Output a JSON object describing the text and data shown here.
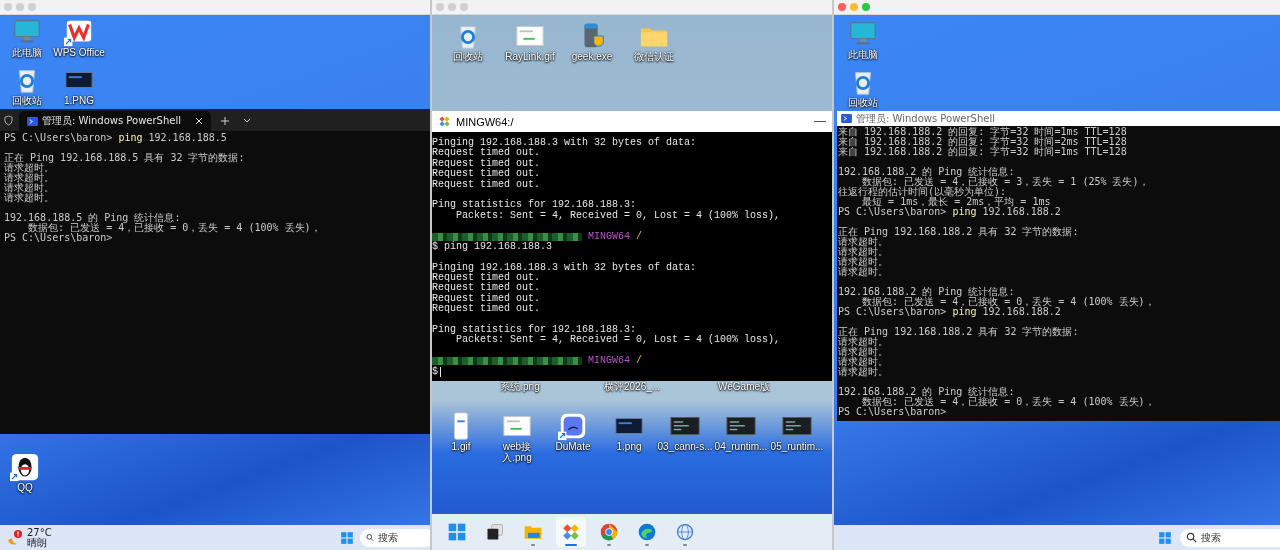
{
  "left_session": {
    "titlebar": {
      "active": false
    },
    "desktop_icons": [
      {
        "label": "此电脑",
        "kind": "monitor",
        "shortcut": false
      },
      {
        "label": "WPS Office",
        "kind": "wps",
        "shortcut": true
      },
      {
        "label": "回收站",
        "kind": "recycle",
        "shortcut": false
      },
      {
        "label": "1.PNG",
        "kind": "dark-thumb",
        "shortcut": false
      }
    ],
    "terminal": {
      "tab": {
        "title": "管理员: Windows PowerShell",
        "selected": true
      },
      "lines": [
        {
          "kind": "command",
          "prompt": "PS C:\\Users\\baron>",
          "command": "ping",
          "args": "192.168.188.5"
        },
        {
          "kind": "blank"
        },
        {
          "kind": "output",
          "text": "正在 Ping 192.168.188.5 具有 32 字节的数据:"
        },
        {
          "kind": "output",
          "text": "请求超时。"
        },
        {
          "kind": "output",
          "text": "请求超时。"
        },
        {
          "kind": "output",
          "text": "请求超时。"
        },
        {
          "kind": "output",
          "text": "请求超时。"
        },
        {
          "kind": "blank"
        },
        {
          "kind": "output",
          "text": "192.168.188.5 的 Ping 统计信息:"
        },
        {
          "kind": "output",
          "text": "    数据包: 已发送 = 4，已接收 = 0，丢失 = 4 (100% 丢失)，"
        },
        {
          "kind": "prompt",
          "prompt": "PS C:\\Users\\baron>"
        }
      ]
    },
    "lower_icons": [
      {
        "label": "QQ",
        "kind": "qq",
        "shortcut": true
      }
    ],
    "taskbar": {
      "weather": {
        "temperature": "27°C",
        "condition": "晴朗"
      },
      "search": {
        "placeholder": "搜索"
      }
    }
  },
  "center_session": {
    "titlebar": {
      "active": false
    },
    "desktop_icons": [
      {
        "label": "回收站",
        "kind": "recycle",
        "shortcut": false
      },
      {
        "label": "RayLink.gif",
        "kind": "gif-thumb",
        "shortcut": false
      },
      {
        "label": "geek.exe",
        "kind": "exe",
        "shortcut": false
      },
      {
        "label": "微信认证",
        "kind": "folder",
        "shortcut": false
      }
    ],
    "terminal": {
      "title": "MINGW64:/",
      "lines": [
        {
          "kind": "output",
          "text": "Pinging 192.168.188.3 with 32 bytes of data:"
        },
        {
          "kind": "output",
          "text": "Request timed out."
        },
        {
          "kind": "output",
          "text": "Request timed out."
        },
        {
          "kind": "output",
          "text": "Request timed out."
        },
        {
          "kind": "output",
          "text": "Request timed out."
        },
        {
          "kind": "blank"
        },
        {
          "kind": "output",
          "text": "Ping statistics for 192.168.188.3:"
        },
        {
          "kind": "output",
          "text": "    Packets: Sent = 4, Received = 0, Lost = 4 (100% loss),"
        },
        {
          "kind": "blank"
        },
        {
          "kind": "prompt",
          "host": "MINGW64",
          "path": "/"
        },
        {
          "kind": "input",
          "symbol": "$",
          "text": "ping 192.168.188.3"
        },
        {
          "kind": "blank"
        },
        {
          "kind": "output",
          "text": "Pinging 192.168.188.3 with 32 bytes of data:"
        },
        {
          "kind": "output",
          "text": "Request timed out."
        },
        {
          "kind": "output",
          "text": "Request timed out."
        },
        {
          "kind": "output",
          "text": "Request timed out."
        },
        {
          "kind": "output",
          "text": "Request timed out."
        },
        {
          "kind": "blank"
        },
        {
          "kind": "output",
          "text": "Ping statistics for 192.168.188.3:"
        },
        {
          "kind": "output",
          "text": "    Packets: Sent = 4, Received = 0, Lost = 4 (100% loss),"
        },
        {
          "kind": "blank"
        },
        {
          "kind": "prompt",
          "host": "MINGW64",
          "path": "/"
        },
        {
          "kind": "cursor",
          "symbol": "$"
        }
      ]
    },
    "hidden_row_labels": [
      "系统.png",
      "横评2026_...",
      "WeGame版"
    ],
    "lower_icons": [
      {
        "label": "1.gif",
        "kind": "phone-thumb",
        "shortcut": false
      },
      {
        "label": "web接入.png",
        "kind": "gif-thumb",
        "shortcut": false
      },
      {
        "label": "DuMate",
        "kind": "app",
        "shortcut": true
      },
      {
        "label": "1.png",
        "kind": "dark-thumb",
        "shortcut": false
      },
      {
        "label": "03_cann-s...",
        "kind": "code-thumb",
        "shortcut": false
      },
      {
        "label": "04_runtim...",
        "kind": "code-thumb",
        "shortcut": false
      },
      {
        "label": "05_runtim...",
        "kind": "code-thumb",
        "shortcut": false
      }
    ],
    "taskbar": {
      "items": [
        {
          "kind": "start",
          "running": false,
          "selected": false
        },
        {
          "kind": "task-view",
          "running": false,
          "selected": false
        },
        {
          "kind": "folder",
          "running": true,
          "selected": false
        },
        {
          "kind": "git",
          "running": true,
          "selected": true
        },
        {
          "kind": "chrome",
          "running": true,
          "selected": false
        },
        {
          "kind": "edge",
          "running": true,
          "selected": false
        },
        {
          "kind": "globe",
          "running": true,
          "selected": false
        }
      ]
    }
  },
  "right_session": {
    "titlebar": {
      "active": true
    },
    "desktop_icons": [
      {
        "label": "此电脑",
        "kind": "monitor",
        "shortcut": false
      },
      {
        "label": "回收站",
        "kind": "recycle",
        "shortcut": false
      }
    ],
    "terminal": {
      "title": "管理员: Windows PowerShell",
      "lines": [
        {
          "kind": "output",
          "text": "来自 192.168.188.2 的回复: 字节=32 时间=1ms TTL=128"
        },
        {
          "kind": "output",
          "text": "来自 192.168.188.2 的回复: 字节=32 时间=2ms TTL=128"
        },
        {
          "kind": "output",
          "text": "来自 192.168.188.2 的回复: 字节=32 时间=1ms TTL=128"
        },
        {
          "kind": "blank"
        },
        {
          "kind": "output",
          "text": "192.168.188.2 的 Ping 统计信息:"
        },
        {
          "kind": "output",
          "text": "    数据包: 已发送 = 4，已接收 = 3，丢失 = 1 (25% 丢失)，"
        },
        {
          "kind": "output",
          "text": "往返行程的估计时间(以毫秒为单位):"
        },
        {
          "kind": "output",
          "text": "    最短 = 1ms，最长 = 2ms，平均 = 1ms"
        },
        {
          "kind": "command",
          "prompt": "PS C:\\Users\\baron>",
          "command": "ping",
          "args": "192.168.188.2"
        },
        {
          "kind": "blank"
        },
        {
          "kind": "output",
          "text": "正在 Ping 192.168.188.2 具有 32 字节的数据:"
        },
        {
          "kind": "output",
          "text": "请求超时。"
        },
        {
          "kind": "output",
          "text": "请求超时。"
        },
        {
          "kind": "output",
          "text": "请求超时。"
        },
        {
          "kind": "output",
          "text": "请求超时。"
        },
        {
          "kind": "blank"
        },
        {
          "kind": "output",
          "text": "192.168.188.2 的 Ping 统计信息:"
        },
        {
          "kind": "output",
          "text": "    数据包: 已发送 = 4，已接收 = 0，丢失 = 4 (100% 丢失)，"
        },
        {
          "kind": "command",
          "prompt": "PS C:\\Users\\baron>",
          "command": "ping",
          "args": "192.168.188.2"
        },
        {
          "kind": "blank"
        },
        {
          "kind": "output",
          "text": "正在 Ping 192.168.188.2 具有 32 字节的数据:"
        },
        {
          "kind": "output",
          "text": "请求超时。"
        },
        {
          "kind": "output",
          "text": "请求超时。"
        },
        {
          "kind": "output",
          "text": "请求超时。"
        },
        {
          "kind": "output",
          "text": "请求超时。"
        },
        {
          "kind": "blank"
        },
        {
          "kind": "output",
          "text": "192.168.188.2 的 Ping 统计信息:"
        },
        {
          "kind": "output",
          "text": "    数据包: 已发送 = 4，已接收 = 0，丢失 = 4 (100% 丢失)，"
        },
        {
          "kind": "prompt",
          "prompt": "PS C:\\Users\\baron>"
        }
      ]
    },
    "taskbar": {
      "search": {
        "placeholder": "搜索"
      }
    }
  }
}
